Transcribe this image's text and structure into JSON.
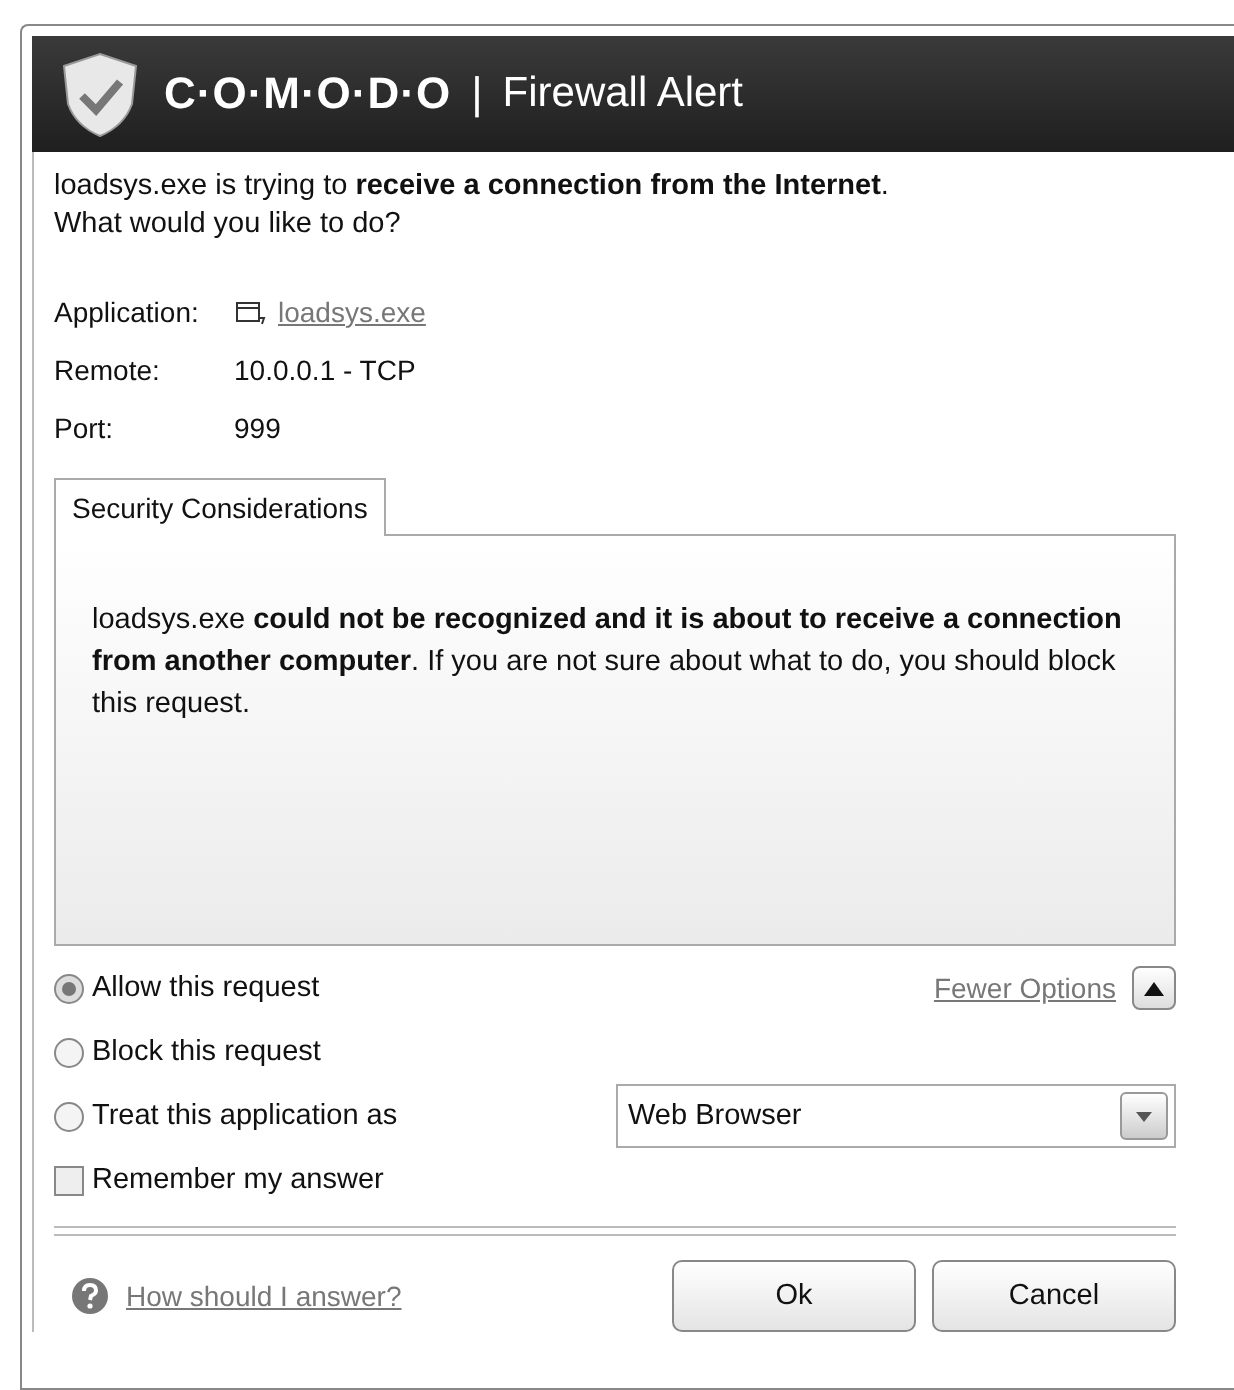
{
  "window": {
    "brand": "C·O·M·O·D·O",
    "separator": "|",
    "title": "Firewall Alert"
  },
  "intro": {
    "text": "loadsys.exe is trying to **receive a connection from the Internet**.",
    "question": "What would you like to do?"
  },
  "details": [
    {
      "label": "Application:",
      "value": "loadsys.exe",
      "kind": "link"
    },
    {
      "label": "Remote:",
      "value": "10.0.0.1 - TCP",
      "kind": "text"
    },
    {
      "label": "Port:",
      "value": "999",
      "kind": "text"
    }
  ],
  "tabs": [
    {
      "label": "Security Considerations",
      "selected": true
    }
  ],
  "message": "loadsys.exe **could not be recognized and it is about to receive a connection from another computer**. If you are not sure about what to do, you should block this request.",
  "fewer_options": "Fewer Options",
  "options": [
    {
      "label": "Allow this request",
      "selected": true
    },
    {
      "label": "Block this request",
      "selected": false
    },
    {
      "label": "Treat this application as",
      "selected": false
    }
  ],
  "treat_as": {
    "value": "Web Browser"
  },
  "remember": {
    "label": "Remember my answer",
    "checked": false
  },
  "help_link": "How should I answer?",
  "buttons": [
    "Ok",
    "Cancel"
  ]
}
